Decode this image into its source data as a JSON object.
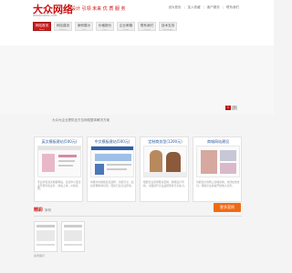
{
  "header": {
    "logo_text": "大众网络",
    "logo_slogan": "设计 引领 未来 优 质 服 务",
    "logo_sub": "WWW.DZWL.COM",
    "top_links": [
      "设为首页",
      "加入收藏",
      "客户服务",
      "联系我们"
    ]
  },
  "nav": [
    {
      "label": "网站首页",
      "sub": "Home",
      "active": true
    },
    {
      "label": "网站建设",
      "sub": "Website",
      "active": false
    },
    {
      "label": "案例展示",
      "sub": "Case",
      "active": false
    },
    {
      "label": "价格报价",
      "sub": "Price",
      "active": false
    },
    {
      "label": "企业邮箱",
      "sub": "Email",
      "active": false
    },
    {
      "label": "联系我们",
      "sub": "Contact",
      "active": false
    },
    {
      "label": "技术支持",
      "sub": "Knowledge",
      "active": false
    }
  ],
  "banner": {
    "caption": "大众为企业提供全方位网络整体解决方案",
    "slider_buttons": [
      "1",
      "2"
    ],
    "active_slide": 0
  },
  "cards": [
    {
      "title": "英文模板建站(500元)",
      "desc": "专业外贸英文模板网站，适合中小型企业开展外贸业务，快速上线，价格实惠。"
    },
    {
      "title": "中文模板建站(500元)",
      "desc": "海量中文模板任意选择，功能齐全，后台管理简单易用，轻松打造企业形象。"
    },
    {
      "title": "定制商务型(1200元)",
      "desc": "根据企业需求量身定制，独特设计风格，全面提升企业品牌形象与竞争力。"
    },
    {
      "title": "商城网站建设",
      "desc": "功能强大的网上商城系统，支持在线支付，帮助企业快速开展电子商务。"
    }
  ],
  "portfolio": {
    "title": "精彩",
    "title_en": "案例",
    "more_label": "更多案例",
    "thumb_caption": "案例展示"
  },
  "colors": {
    "brand_red": "#c81e1e",
    "link_blue": "#2a5a9a",
    "accent_orange": "#f06a14"
  }
}
